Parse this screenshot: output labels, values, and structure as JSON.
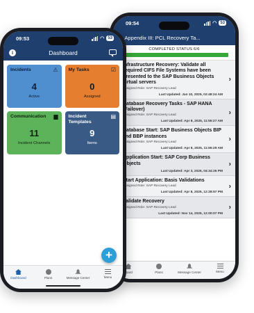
{
  "back_phone": {
    "status": {
      "time": "09:54",
      "battery": "53"
    },
    "header": {
      "back": "‹",
      "title": "Appendix III: PCL Recovery Ta..."
    },
    "progress": {
      "label": "COMPLETED STATUS 6/6",
      "fraction": 1.0
    },
    "tasks": [
      {
        "title": "Infrastructure Recovery: Validate all required CIFS File Systems have been presented to the SAP Business Objects virtual servers",
        "role": "Assigned Role: SAP Recovery Lead",
        "updated": "Last Updated: Jan 10, 2025, 02:48:24 AM"
      },
      {
        "title": "Database Recovery Tasks - SAP HANA (Failover)",
        "role": "Assigned Role: SAP Recovery Lead",
        "updated": "Last Updated: Apr 8, 2025, 11:55:27 AM"
      },
      {
        "title": "Database Start: SAP Business Objects BIP and BBP instances",
        "role": "Assigned Role: SAP Recovery Lead",
        "updated": "Last Updated: Apr 8, 2025, 11:55:29 AM"
      },
      {
        "title": "Application Start: SAP Corp Business Objects",
        "role": "",
        "updated": "Last Updated: Apr 3, 2025, 04:34:26 PM"
      },
      {
        "title": "Start Application: Basis Validations",
        "role": "Assigned Role: SAP Recovery Lead",
        "updated": "Last Updated: Apr 8, 2025, 12:28:57 PM"
      },
      {
        "title": "Validate Recovery",
        "role": "Assigned Role: SAP Recovery Lead",
        "updated": "Last Updated: Nov 14, 2025, 12:00:07 PM"
      }
    ],
    "tabs": [
      "board",
      "Plans",
      "Message Center",
      "Menu"
    ]
  },
  "front_phone": {
    "status": {
      "time": "09:53",
      "battery": "53"
    },
    "header": {
      "title": "Dashboard"
    },
    "tiles": [
      {
        "title": "Incidents",
        "number": "4",
        "subtitle": "Active",
        "icon": "warning-icon",
        "icon_glyph": "⚠",
        "color": "#4f8fd0"
      },
      {
        "title": "My Tasks",
        "number": "0",
        "subtitle": "Assigned",
        "icon": "clipboard-check-icon",
        "icon_glyph": "☑",
        "color": "#e67e2f"
      },
      {
        "title": "Communication",
        "number": "11",
        "subtitle": "Incident Channels",
        "icon": "chat-icon",
        "icon_glyph": "▆",
        "color": "#5db35a"
      },
      {
        "title": "Incident Templates",
        "number": "9",
        "subtitle": "Items",
        "icon": "template-icon",
        "icon_glyph": "▤",
        "color": "#3a5a86"
      }
    ],
    "fab": "+",
    "tabs": [
      "Dashboard",
      "Plans",
      "Message Center",
      "Menu"
    ]
  },
  "colors": {
    "header": "#1f3f6e",
    "accent": "#2d9fd8",
    "progress": "#36a83a"
  }
}
